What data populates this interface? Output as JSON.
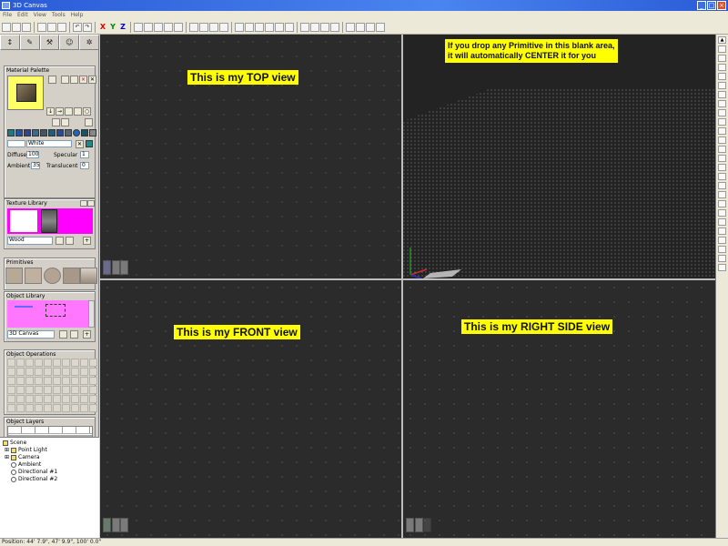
{
  "window": {
    "title": "3D Canvas"
  },
  "menu": [
    "File",
    "Edit",
    "View",
    "Tools",
    "Help"
  ],
  "toolbar": {
    "axis_x": "X",
    "axis_y": "Y",
    "axis_z": "Z"
  },
  "left_panel": {
    "material_palette": {
      "title": "Material Palette",
      "color_name": "White",
      "diffuse_label": "Diffuse",
      "diffuse_value": "100",
      "specular_label": "Specular",
      "specular_value": "1",
      "ambient_label": "Ambient",
      "ambient_value": "35",
      "translucent_label": "Translucent",
      "translucent_value": "0"
    },
    "texture_library": {
      "title": "Texture Library",
      "selected": "Wood"
    },
    "primitives": {
      "title": "Primitives"
    },
    "object_library": {
      "title": "Object Library",
      "selected": "3D Canvas"
    },
    "object_operations": {
      "title": "Object Operations"
    },
    "object_layers": {
      "title": "Object Layers"
    }
  },
  "scene_tree": {
    "items": [
      "Scene",
      "Point Light",
      "Camera",
      "Ambient",
      "Directional #1",
      "Directional #2"
    ]
  },
  "viewports": {
    "top_label": "This is my TOP view",
    "perspective_note_line1": "If you drop any Primitive in this blank area,",
    "perspective_note_line2": "it will automatically CENTER it for you",
    "front_label": "This is my FRONT view",
    "right_label": "This is my RIGHT SIDE view"
  },
  "status": {
    "position": "Position: 44' 7.9\", 47' 9.9\", 100' 0.0\""
  },
  "colors": {
    "label_bg": "#ffff00",
    "viewport_bg": "#2b2b2b",
    "texture_magenta": "#ff00ff"
  }
}
